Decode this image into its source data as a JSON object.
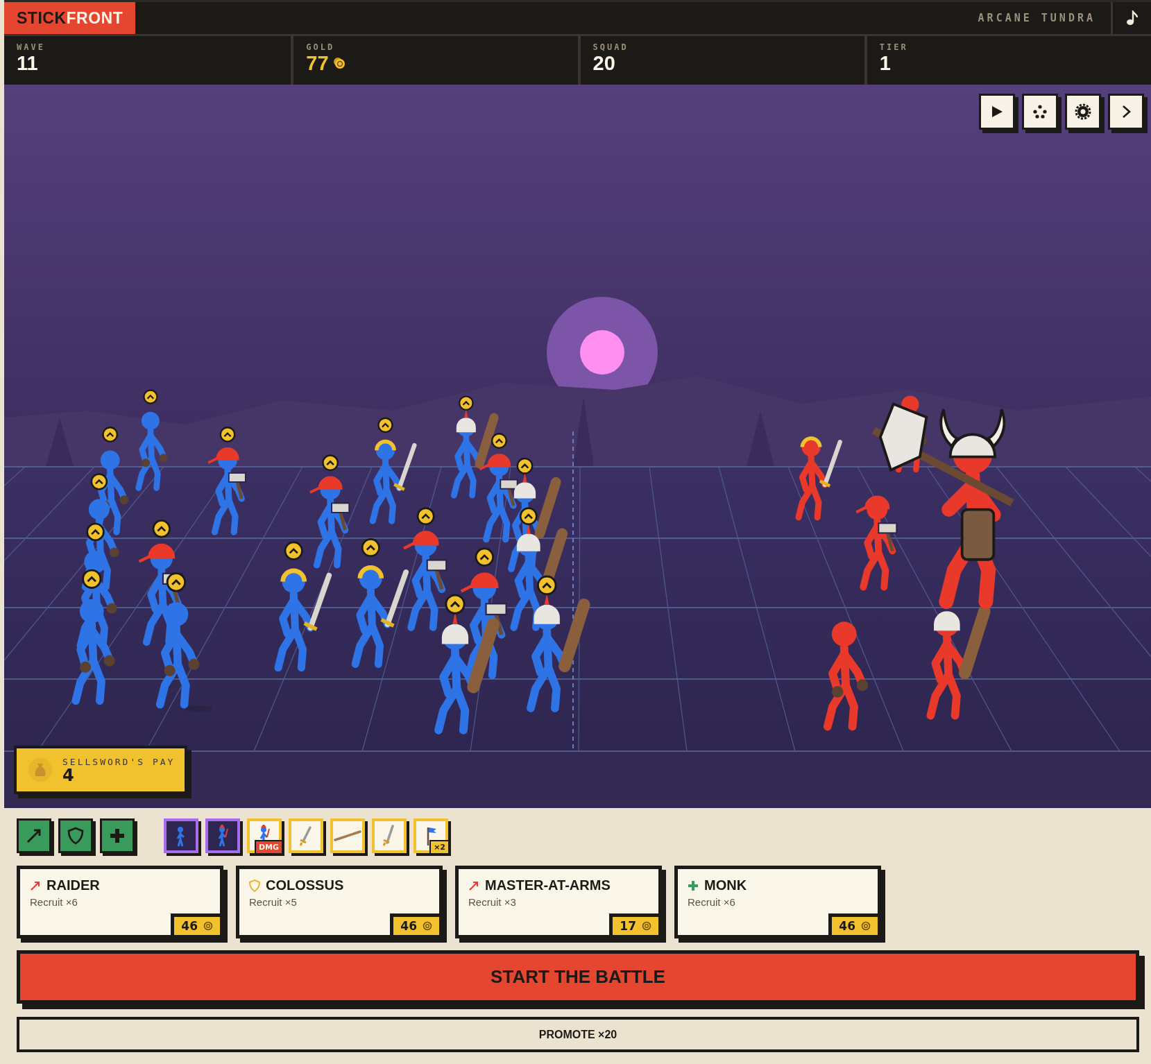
{
  "header": {
    "logo": {
      "dark": "STICK",
      "light": "FRONT"
    },
    "location": "ARCANE TUNDRA"
  },
  "stats": [
    {
      "label": "WAVE",
      "value": "11",
      "kind": "plain"
    },
    {
      "label": "GOLD",
      "value": "77",
      "kind": "gold"
    },
    {
      "label": "SQUAD",
      "value": "20",
      "kind": "plain"
    },
    {
      "label": "TIER",
      "value": "1",
      "kind": "plain"
    }
  ],
  "sellsword": {
    "label": "SELLSWORD'S PAY",
    "value": "4"
  },
  "inventory": [
    {
      "kind": "soldier",
      "color": "#a66cf0"
    },
    {
      "kind": "knight",
      "color": "#a66cf0"
    },
    {
      "kind": "knight",
      "color": "#f2c12e",
      "badge": {
        "text": "DMG",
        "color": "#e5462f"
      }
    },
    {
      "kind": "dagger",
      "color": "#f2c12e"
    },
    {
      "kind": "spear",
      "color": "#f2c12e"
    },
    {
      "kind": "sword",
      "color": "#f2c12e"
    },
    {
      "kind": "banner",
      "color": "#f2c12e",
      "badge": {
        "text": "×2",
        "color": "#f2c12e"
      }
    }
  ],
  "recruits": [
    {
      "kind": "attack",
      "name": "RAIDER",
      "detail": "Recruit ×6",
      "price": "46"
    },
    {
      "kind": "defense",
      "name": "COLOSSUS",
      "detail": "Recruit ×5",
      "price": "46"
    },
    {
      "kind": "attack",
      "name": "MASTER-AT-ARMS",
      "detail": "Recruit ×3",
      "price": "17"
    },
    {
      "kind": "heal",
      "name": "MONK",
      "detail": "Recruit ×6",
      "price": "46"
    }
  ],
  "actions": {
    "primary": "START THE BATTLE",
    "secondary": "PROMOTE ×20"
  }
}
